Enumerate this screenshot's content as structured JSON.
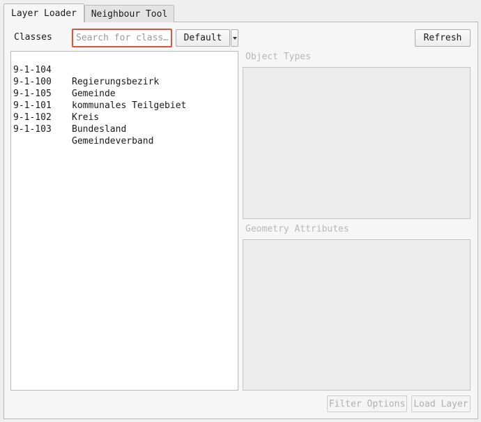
{
  "tabs": [
    {
      "label": "Layer Loader"
    },
    {
      "label": "Neighbour Tool"
    }
  ],
  "classes_label": "Classes",
  "search": {
    "placeholder": "Search for class…",
    "value": ""
  },
  "preset": {
    "label": "Default",
    "icon": "chevron-down-icon"
  },
  "refresh_label": "Refresh",
  "classes": [
    {
      "code": "9-1-104",
      "name": "Regierungsbezirk"
    },
    {
      "code": "9-1-100",
      "name": "Gemeinde"
    },
    {
      "code": "9-1-105",
      "name": "kommunales Teilgebiet"
    },
    {
      "code": "9-1-101",
      "name": "Kreis"
    },
    {
      "code": "9-1-102",
      "name": "Bundesland"
    },
    {
      "code": "9-1-103",
      "name": "Gemeindeverband"
    }
  ],
  "object_types_label": "Object Types",
  "geometry_attributes_label": "Geometry Attributes",
  "filter_options_label": "Filter Options",
  "load_layer_label": "Load Layer",
  "colors": {
    "search_focus_border": "#e0533a",
    "disabled_text": "#b0b0b0"
  }
}
